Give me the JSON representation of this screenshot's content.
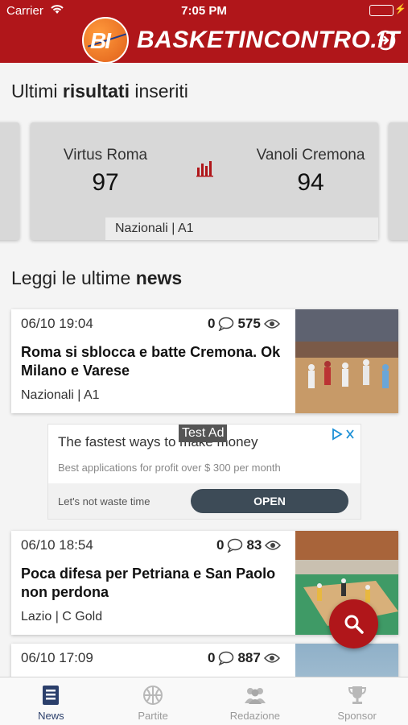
{
  "status_bar": {
    "carrier": "Carrier",
    "time": "7:05 PM"
  },
  "header": {
    "logo_mark": "BI",
    "logo_text": "BASKETINCONTRO.IT"
  },
  "results_section": {
    "title_pre": "Ultimi ",
    "title_bold": "risultati",
    "title_post": " inseriti"
  },
  "result": {
    "home_team": "Virtus Roma",
    "home_score": "97",
    "away_team": "Vanoli Cremona",
    "away_score": "94",
    "league": "Nazionali | A1"
  },
  "news_section": {
    "title_pre": "Leggi le ultime ",
    "title_bold": "news"
  },
  "news": [
    {
      "date": "06/10 19:04",
      "comments": "0",
      "views": "575",
      "headline": "Roma si sblocca e batte Cremona. Ok Milano e Varese",
      "category": "Nazionali | A1"
    },
    {
      "date": "06/10 18:54",
      "comments": "0",
      "views": "83",
      "headline": "Poca difesa per Petriana e San Paolo non perdona",
      "category": "Lazio | C Gold"
    },
    {
      "date": "06/10 17:09",
      "comments": "0",
      "views": "887"
    }
  ],
  "ad": {
    "badge": "Test Ad",
    "title": "The fastest ways to make money",
    "subtitle": "Best applications for profit over $ 300 per month",
    "note": "Let's not waste time",
    "cta": "OPEN"
  },
  "tabs": [
    {
      "label": "News",
      "icon": "news-icon",
      "active": true
    },
    {
      "label": "Partite",
      "icon": "basketball-icon",
      "active": false
    },
    {
      "label": "Redazione",
      "icon": "team-icon",
      "active": false
    },
    {
      "label": "Sponsor",
      "icon": "trophy-icon",
      "active": false
    }
  ],
  "colors": {
    "brand_red": "#b0161a",
    "tab_active": "#2b3f6b",
    "tab_inactive": "#9a9a9a"
  }
}
